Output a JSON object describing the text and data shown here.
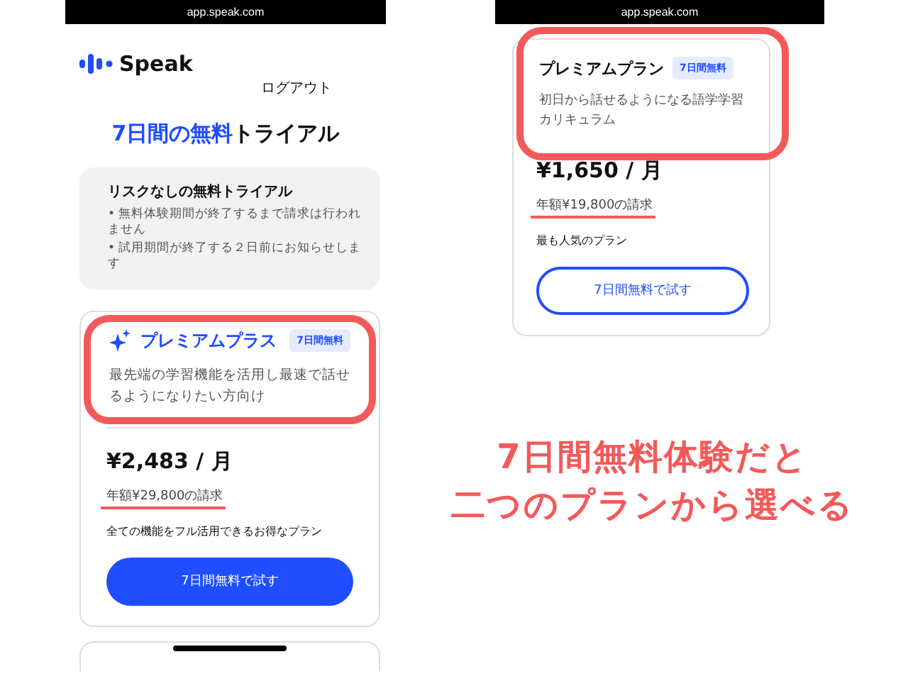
{
  "screens": [
    {
      "url": "app.speak.com",
      "brand": "Speak",
      "logout": "ログアウト",
      "title_accent": "7日間の無料",
      "title_rest": "トライアル",
      "notice": {
        "title": "リスクなしの無料トライアル",
        "bullets": [
          "• 無料体験期間が終了するまで請求は行われません",
          "• 試用期間が終了する２日前にお知らせします"
        ]
      },
      "plans": [
        {
          "name": "プレミアムプラス",
          "sparkle": true,
          "badge": "7日間無料",
          "description": "最先端の学習機能を活用し最速で話せるようになりたい方向け",
          "highlighted": true,
          "price": "¥2,483 / 月",
          "annual": "年額¥29,800の請求",
          "annual_underlined": true,
          "note": "全ての機能をフル活用できるお得なプラン",
          "button": {
            "label": "7日間無料で試す",
            "kind": "filled"
          }
        }
      ],
      "more_card": true
    },
    {
      "url": "app.speak.com",
      "plans": [
        {
          "name": "プレミアムプラン",
          "sparkle": false,
          "badge": "7日間無料",
          "description": "初日から話せるようになる語学学習カリキュラム",
          "highlighted": true,
          "price": "¥1,650 / 月",
          "annual": "年額¥19,800の請求",
          "annual_underlined": true,
          "note": "最も人気のプラン",
          "button": {
            "label": "7日間無料で試す",
            "kind": "outline"
          }
        }
      ]
    }
  ],
  "caption": [
    "7日間無料体験だと",
    "二つのプランから選べる"
  ]
}
